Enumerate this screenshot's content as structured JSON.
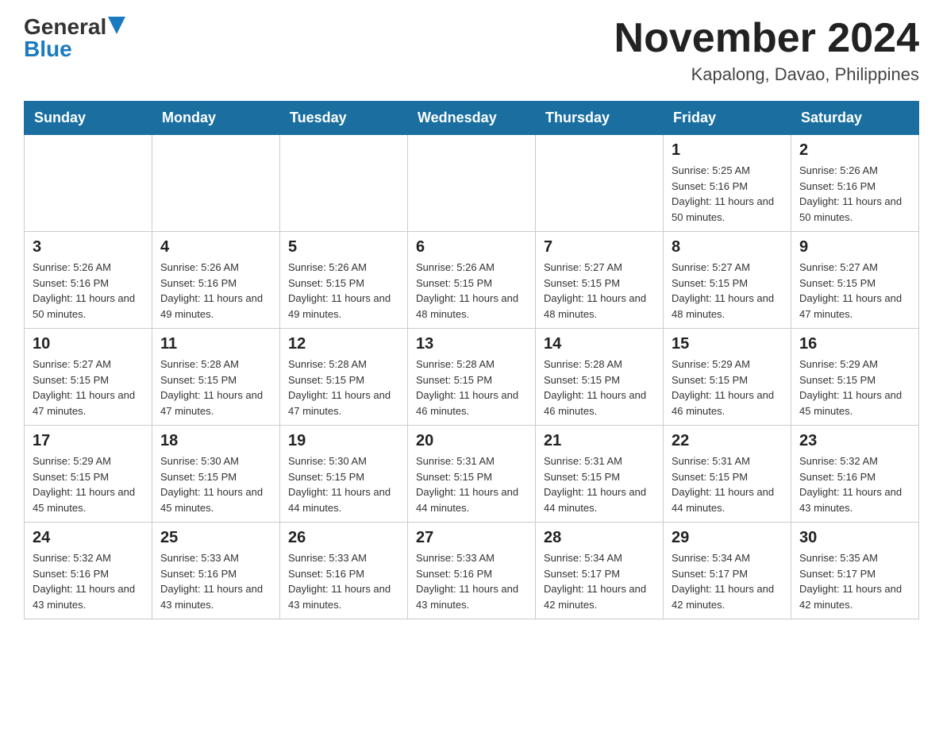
{
  "header": {
    "logo_general": "General",
    "logo_blue": "Blue",
    "month_title": "November 2024",
    "location": "Kapalong, Davao, Philippines"
  },
  "days_of_week": [
    "Sunday",
    "Monday",
    "Tuesday",
    "Wednesday",
    "Thursday",
    "Friday",
    "Saturday"
  ],
  "weeks": [
    [
      {
        "day": "",
        "info": ""
      },
      {
        "day": "",
        "info": ""
      },
      {
        "day": "",
        "info": ""
      },
      {
        "day": "",
        "info": ""
      },
      {
        "day": "",
        "info": ""
      },
      {
        "day": "1",
        "info": "Sunrise: 5:25 AM\nSunset: 5:16 PM\nDaylight: 11 hours and 50 minutes."
      },
      {
        "day": "2",
        "info": "Sunrise: 5:26 AM\nSunset: 5:16 PM\nDaylight: 11 hours and 50 minutes."
      }
    ],
    [
      {
        "day": "3",
        "info": "Sunrise: 5:26 AM\nSunset: 5:16 PM\nDaylight: 11 hours and 50 minutes."
      },
      {
        "day": "4",
        "info": "Sunrise: 5:26 AM\nSunset: 5:16 PM\nDaylight: 11 hours and 49 minutes."
      },
      {
        "day": "5",
        "info": "Sunrise: 5:26 AM\nSunset: 5:15 PM\nDaylight: 11 hours and 49 minutes."
      },
      {
        "day": "6",
        "info": "Sunrise: 5:26 AM\nSunset: 5:15 PM\nDaylight: 11 hours and 48 minutes."
      },
      {
        "day": "7",
        "info": "Sunrise: 5:27 AM\nSunset: 5:15 PM\nDaylight: 11 hours and 48 minutes."
      },
      {
        "day": "8",
        "info": "Sunrise: 5:27 AM\nSunset: 5:15 PM\nDaylight: 11 hours and 48 minutes."
      },
      {
        "day": "9",
        "info": "Sunrise: 5:27 AM\nSunset: 5:15 PM\nDaylight: 11 hours and 47 minutes."
      }
    ],
    [
      {
        "day": "10",
        "info": "Sunrise: 5:27 AM\nSunset: 5:15 PM\nDaylight: 11 hours and 47 minutes."
      },
      {
        "day": "11",
        "info": "Sunrise: 5:28 AM\nSunset: 5:15 PM\nDaylight: 11 hours and 47 minutes."
      },
      {
        "day": "12",
        "info": "Sunrise: 5:28 AM\nSunset: 5:15 PM\nDaylight: 11 hours and 47 minutes."
      },
      {
        "day": "13",
        "info": "Sunrise: 5:28 AM\nSunset: 5:15 PM\nDaylight: 11 hours and 46 minutes."
      },
      {
        "day": "14",
        "info": "Sunrise: 5:28 AM\nSunset: 5:15 PM\nDaylight: 11 hours and 46 minutes."
      },
      {
        "day": "15",
        "info": "Sunrise: 5:29 AM\nSunset: 5:15 PM\nDaylight: 11 hours and 46 minutes."
      },
      {
        "day": "16",
        "info": "Sunrise: 5:29 AM\nSunset: 5:15 PM\nDaylight: 11 hours and 45 minutes."
      }
    ],
    [
      {
        "day": "17",
        "info": "Sunrise: 5:29 AM\nSunset: 5:15 PM\nDaylight: 11 hours and 45 minutes."
      },
      {
        "day": "18",
        "info": "Sunrise: 5:30 AM\nSunset: 5:15 PM\nDaylight: 11 hours and 45 minutes."
      },
      {
        "day": "19",
        "info": "Sunrise: 5:30 AM\nSunset: 5:15 PM\nDaylight: 11 hours and 44 minutes."
      },
      {
        "day": "20",
        "info": "Sunrise: 5:31 AM\nSunset: 5:15 PM\nDaylight: 11 hours and 44 minutes."
      },
      {
        "day": "21",
        "info": "Sunrise: 5:31 AM\nSunset: 5:15 PM\nDaylight: 11 hours and 44 minutes."
      },
      {
        "day": "22",
        "info": "Sunrise: 5:31 AM\nSunset: 5:15 PM\nDaylight: 11 hours and 44 minutes."
      },
      {
        "day": "23",
        "info": "Sunrise: 5:32 AM\nSunset: 5:16 PM\nDaylight: 11 hours and 43 minutes."
      }
    ],
    [
      {
        "day": "24",
        "info": "Sunrise: 5:32 AM\nSunset: 5:16 PM\nDaylight: 11 hours and 43 minutes."
      },
      {
        "day": "25",
        "info": "Sunrise: 5:33 AM\nSunset: 5:16 PM\nDaylight: 11 hours and 43 minutes."
      },
      {
        "day": "26",
        "info": "Sunrise: 5:33 AM\nSunset: 5:16 PM\nDaylight: 11 hours and 43 minutes."
      },
      {
        "day": "27",
        "info": "Sunrise: 5:33 AM\nSunset: 5:16 PM\nDaylight: 11 hours and 43 minutes."
      },
      {
        "day": "28",
        "info": "Sunrise: 5:34 AM\nSunset: 5:17 PM\nDaylight: 11 hours and 42 minutes."
      },
      {
        "day": "29",
        "info": "Sunrise: 5:34 AM\nSunset: 5:17 PM\nDaylight: 11 hours and 42 minutes."
      },
      {
        "day": "30",
        "info": "Sunrise: 5:35 AM\nSunset: 5:17 PM\nDaylight: 11 hours and 42 minutes."
      }
    ]
  ]
}
